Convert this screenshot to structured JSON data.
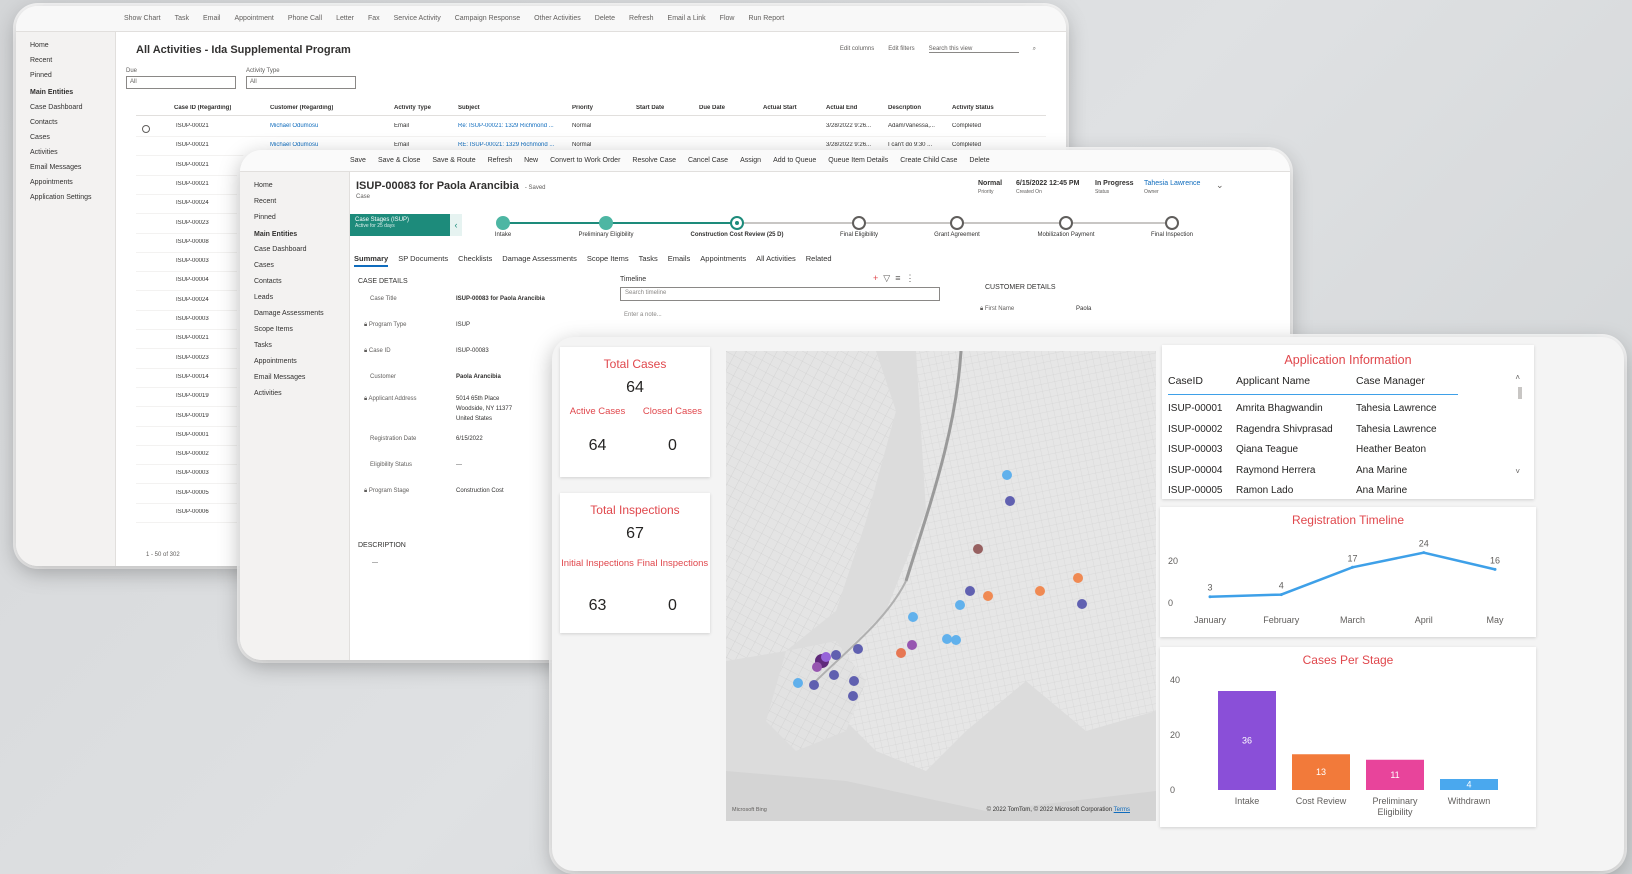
{
  "win1": {
    "commands": [
      "Show Chart",
      "Task",
      "Email",
      "Appointment",
      "Phone Call",
      "Letter",
      "Fax",
      "Service Activity",
      "Campaign Response",
      "Other Activities",
      "Delete",
      "Refresh",
      "Email a Link",
      "Flow",
      "Run Report"
    ],
    "nav": {
      "top": [
        "Home",
        "Recent",
        "Pinned"
      ],
      "section": "Main Entities",
      "items": [
        "Case Dashboard",
        "Contacts",
        "Cases",
        "Activities",
        "Email Messages",
        "Appointments",
        "Application Settings"
      ]
    },
    "title": "All Activities - Ida Supplemental Program",
    "tools": [
      "Edit columns",
      "Edit filters",
      "Search this view"
    ],
    "filter1": {
      "label": "Due",
      "value": "All"
    },
    "filter2": {
      "label": "Activity Type",
      "value": "All"
    },
    "columns": [
      "Case ID (Regarding)",
      "Customer (Regarding)",
      "Activity Type",
      "Subject",
      "Priority",
      "Start Date",
      "Due Date",
      "Actual Start",
      "Actual End",
      "Description",
      "Activity Status"
    ],
    "rows": [
      {
        "id": "ISUP-00021",
        "customer": "Michael Odumosu",
        "type": "Email",
        "subject": "Re: ISUP-00021: 1329 Richmond ...",
        "priority": "Normal",
        "end": "3/28/2022 9:26...",
        "desc": "Adam/Vanessa,...",
        "status": "Completed"
      },
      {
        "id": "ISUP-00021",
        "customer": "Michael Odumosu",
        "type": "Email",
        "subject": "RE: ISUP-00021: 1329 Richmond ...",
        "priority": "Normal",
        "end": "3/28/2022 9:26...",
        "desc": "I can't do 9:30 ...",
        "status": "Completed"
      },
      {
        "id": "ISUP-00021"
      },
      {
        "id": "ISUP-00021"
      },
      {
        "id": "ISUP-00024"
      },
      {
        "id": "ISUP-00023"
      },
      {
        "id": "ISUP-00008"
      },
      {
        "id": "ISUP-00003"
      },
      {
        "id": "ISUP-00004"
      },
      {
        "id": "ISUP-00024"
      },
      {
        "id": "ISUP-00003"
      },
      {
        "id": "ISUP-00021"
      },
      {
        "id": "ISUP-00023"
      },
      {
        "id": "ISUP-00014"
      },
      {
        "id": "ISUP-00019"
      },
      {
        "id": "ISUP-00019"
      },
      {
        "id": "ISUP-00001"
      },
      {
        "id": "ISUP-00002"
      },
      {
        "id": "ISUP-00003"
      },
      {
        "id": "ISUP-00005"
      },
      {
        "id": "ISUP-00006"
      }
    ],
    "footer": "1 - 50 of 302"
  },
  "win2": {
    "commands": [
      "Save",
      "Save & Close",
      "Save & Route",
      "Refresh",
      "New",
      "Convert to Work Order",
      "Resolve Case",
      "Cancel Case",
      "Assign",
      "Add to Queue",
      "Queue Item Details",
      "Create Child Case",
      "Delete"
    ],
    "nav": {
      "top": [
        "Home",
        "Recent",
        "Pinned"
      ],
      "section": "Main Entities",
      "items": [
        "Case Dashboard",
        "Cases",
        "Contacts",
        "Leads",
        "Damage Assessments",
        "Scope Items",
        "Tasks",
        "Appointments",
        "Email Messages",
        "Activities"
      ]
    },
    "title": "ISUP-00083 for Paola Arancibia",
    "saved": "- Saved",
    "entity": "Case",
    "header_fields": [
      {
        "value": "Normal",
        "label": "Priority"
      },
      {
        "value": "6/15/2022 12:45 PM",
        "label": "Created On"
      },
      {
        "value": "In Progress",
        "label": "Status"
      },
      {
        "value": "Tahesia Lawrence",
        "label": "Owner"
      }
    ],
    "stage_active": {
      "name": "Case Stages (ISUP)",
      "duration": "Active for 25 days"
    },
    "stages": [
      "Intake",
      "Preliminary Eligibility",
      "Construction Cost Review (25 D)",
      "Final Eligibility",
      "Grant Agreement",
      "Mobilization Payment",
      "Final Inspection"
    ],
    "tabs": [
      "Summary",
      "SP Documents",
      "Checklists",
      "Damage Assessments",
      "Scope Items",
      "Tasks",
      "Emails",
      "Appointments",
      "All Activities",
      "Related"
    ],
    "case_details_header": "CASE DETAILS",
    "fields": [
      {
        "label": "Case Title",
        "value": "ISUP-00083 for Paola Arancibia"
      },
      {
        "label": "Program Type",
        "value": "ISUP"
      },
      {
        "label": "Case ID",
        "value": "ISUP-00083"
      },
      {
        "label": "Customer",
        "value": "Paola Arancibia"
      },
      {
        "label": "Applicant Address",
        "value": "5014 65th Place",
        "value2": "Woodside, NY 11377",
        "value3": "United States"
      },
      {
        "label": "Registration Date",
        "value": "6/15/2022"
      },
      {
        "label": "Eligibility Status",
        "value": "---"
      },
      {
        "label": "Program Stage",
        "value": "Construction Cost"
      }
    ],
    "description_header": "DESCRIPTION",
    "description_value": "---",
    "timeline_header": "Timeline",
    "timeline_search": "Search timeline",
    "timeline_note": "Enter a note...",
    "customer_details_header": "CUSTOMER DETAILS",
    "customer_first_name_label": "First Name",
    "customer_first_name": "Paola"
  },
  "dashboard": {
    "total_cases": {
      "title": "Total Cases",
      "value": "64",
      "active_label": "Active Cases",
      "active": "64",
      "closed_label": "Closed Cases",
      "closed": "0"
    },
    "inspections": {
      "title": "Total Inspections",
      "value": "67",
      "initial_label": "Initial Inspections",
      "initial": "63",
      "final_label": "Final Inspections",
      "final": "0"
    },
    "map_credit": "© 2022 TomTom, © 2022 Microsoft Corporation",
    "map_terms": "Terms",
    "map_logo": "Microsoft Bing",
    "app_info": {
      "title": "Application Information",
      "headers": [
        "CaseID",
        "Applicant Name",
        "Case Manager"
      ],
      "rows": [
        [
          "ISUP-00001",
          "Amrita Bhagwandin",
          "Tahesia Lawrence"
        ],
        [
          "ISUP-00002",
          "Ragendra Shivprasad",
          "Tahesia Lawrence"
        ],
        [
          "ISUP-00003",
          "Qiana Teague",
          "Heather Beaton"
        ],
        [
          "ISUP-00004",
          "Raymond Herrera",
          "Ana Marine"
        ],
        [
          "ISUP-00005",
          "Ramon Lado",
          "Ana Marine"
        ]
      ]
    },
    "colors": {
      "accent": "#e0474c",
      "line": "#3ea0e8",
      "bar_intake": "#8a4fd8",
      "bar_cost": "#f27a3a",
      "bar_prelim": "#e8449b",
      "bar_withdrawn": "#4aa8ee"
    }
  },
  "chart_data": [
    {
      "type": "line",
      "title": "Registration Timeline",
      "categories": [
        "January",
        "February",
        "March",
        "April",
        "May"
      ],
      "values": [
        3,
        4,
        17,
        24,
        16
      ],
      "yticks": [
        "0",
        "20"
      ],
      "ylim": [
        0,
        30
      ]
    },
    {
      "type": "bar",
      "title": "Cases Per Stage",
      "categories": [
        "Intake",
        "Cost Review",
        "Preliminary Eligibility",
        "Withdrawn"
      ],
      "values": [
        36,
        13,
        11,
        4
      ],
      "yticks": [
        "0",
        "20",
        "40"
      ],
      "ylim": [
        0,
        40
      ]
    }
  ]
}
